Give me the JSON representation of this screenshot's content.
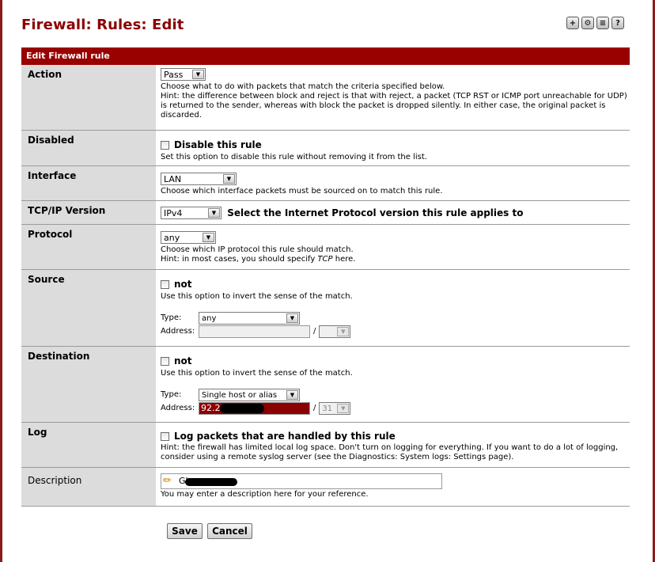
{
  "page": {
    "title": "Firewall: Rules: Edit"
  },
  "top_icons": [
    "add-icon",
    "settings-icon",
    "log-icon",
    "help-icon"
  ],
  "section": {
    "title": "Edit Firewall rule"
  },
  "rows": {
    "action": {
      "label": "Action",
      "selected": "Pass",
      "help1": "Choose what to do with packets that match the criteria specified below.",
      "help2": "Hint: the difference between block and reject is that with reject, a packet (TCP RST or ICMP port unreachable for UDP) is returned to the sender, whereas with block the packet is dropped silently. In either case, the original packet is discarded."
    },
    "disabled": {
      "label": "Disabled",
      "checkbox_label": "Disable this rule",
      "help": "Set this option to disable this rule without removing it from the list."
    },
    "interface": {
      "label": "Interface",
      "selected": "LAN",
      "help": "Choose which interface packets must be sourced on to match this rule."
    },
    "tcpip": {
      "label": "TCP/IP Version",
      "selected": "IPv4",
      "text": "Select the Internet Protocol version this rule applies to"
    },
    "protocol": {
      "label": "Protocol",
      "selected": "any",
      "help1": "Choose which IP protocol this rule should match.",
      "help2_pre": "Hint: in most cases, you should specify ",
      "help2_em": "TCP",
      "help2_post": " here."
    },
    "source": {
      "label": "Source",
      "not_label": "not",
      "help": "Use this option to invert the sense of the match.",
      "type_label": "Type:",
      "type_value": "any",
      "address_label": "Address:",
      "slash": "/"
    },
    "destination": {
      "label": "Destination",
      "not_label": "not",
      "help": "Use this option to invert the sense of the match.",
      "type_label": "Type:",
      "type_value": "Single host or alias",
      "address_label": "Address:",
      "address_value": "92.2",
      "slash": "/",
      "mask": "31"
    },
    "log": {
      "label": "Log",
      "checkbox_label": "Log packets that are handled by this rule",
      "help": "Hint: the firewall has limited local log space. Don't turn on logging for everything. If you want to do a lot of logging, consider using a remote syslog server (see the Diagnostics: System logs: Settings page)."
    },
    "description": {
      "label": "Description",
      "value": "Gl",
      "help": "You may enter a description here for your reference."
    }
  },
  "buttons": {
    "save": "Save",
    "cancel": "Cancel"
  },
  "colors": {
    "title": "#8b0000",
    "header_bar": "#990000",
    "label_bg": "#dcdcdc",
    "highlight_field": "#8b0000"
  }
}
